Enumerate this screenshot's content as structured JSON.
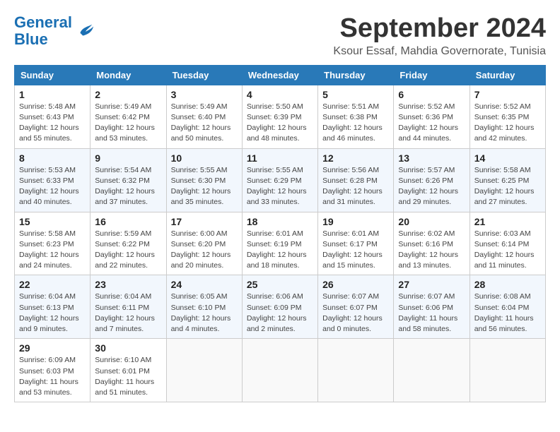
{
  "header": {
    "logo_line1": "General",
    "logo_line2": "Blue",
    "month_title": "September 2024",
    "subtitle": "Ksour Essaf, Mahdia Governorate, Tunisia"
  },
  "weekdays": [
    "Sunday",
    "Monday",
    "Tuesday",
    "Wednesday",
    "Thursday",
    "Friday",
    "Saturday"
  ],
  "weeks": [
    [
      {
        "day": "1",
        "info": "Sunrise: 5:48 AM\nSunset: 6:43 PM\nDaylight: 12 hours\nand 55 minutes."
      },
      {
        "day": "2",
        "info": "Sunrise: 5:49 AM\nSunset: 6:42 PM\nDaylight: 12 hours\nand 53 minutes."
      },
      {
        "day": "3",
        "info": "Sunrise: 5:49 AM\nSunset: 6:40 PM\nDaylight: 12 hours\nand 50 minutes."
      },
      {
        "day": "4",
        "info": "Sunrise: 5:50 AM\nSunset: 6:39 PM\nDaylight: 12 hours\nand 48 minutes."
      },
      {
        "day": "5",
        "info": "Sunrise: 5:51 AM\nSunset: 6:38 PM\nDaylight: 12 hours\nand 46 minutes."
      },
      {
        "day": "6",
        "info": "Sunrise: 5:52 AM\nSunset: 6:36 PM\nDaylight: 12 hours\nand 44 minutes."
      },
      {
        "day": "7",
        "info": "Sunrise: 5:52 AM\nSunset: 6:35 PM\nDaylight: 12 hours\nand 42 minutes."
      }
    ],
    [
      {
        "day": "8",
        "info": "Sunrise: 5:53 AM\nSunset: 6:33 PM\nDaylight: 12 hours\nand 40 minutes."
      },
      {
        "day": "9",
        "info": "Sunrise: 5:54 AM\nSunset: 6:32 PM\nDaylight: 12 hours\nand 37 minutes."
      },
      {
        "day": "10",
        "info": "Sunrise: 5:55 AM\nSunset: 6:30 PM\nDaylight: 12 hours\nand 35 minutes."
      },
      {
        "day": "11",
        "info": "Sunrise: 5:55 AM\nSunset: 6:29 PM\nDaylight: 12 hours\nand 33 minutes."
      },
      {
        "day": "12",
        "info": "Sunrise: 5:56 AM\nSunset: 6:28 PM\nDaylight: 12 hours\nand 31 minutes."
      },
      {
        "day": "13",
        "info": "Sunrise: 5:57 AM\nSunset: 6:26 PM\nDaylight: 12 hours\nand 29 minutes."
      },
      {
        "day": "14",
        "info": "Sunrise: 5:58 AM\nSunset: 6:25 PM\nDaylight: 12 hours\nand 27 minutes."
      }
    ],
    [
      {
        "day": "15",
        "info": "Sunrise: 5:58 AM\nSunset: 6:23 PM\nDaylight: 12 hours\nand 24 minutes."
      },
      {
        "day": "16",
        "info": "Sunrise: 5:59 AM\nSunset: 6:22 PM\nDaylight: 12 hours\nand 22 minutes."
      },
      {
        "day": "17",
        "info": "Sunrise: 6:00 AM\nSunset: 6:20 PM\nDaylight: 12 hours\nand 20 minutes."
      },
      {
        "day": "18",
        "info": "Sunrise: 6:01 AM\nSunset: 6:19 PM\nDaylight: 12 hours\nand 18 minutes."
      },
      {
        "day": "19",
        "info": "Sunrise: 6:01 AM\nSunset: 6:17 PM\nDaylight: 12 hours\nand 15 minutes."
      },
      {
        "day": "20",
        "info": "Sunrise: 6:02 AM\nSunset: 6:16 PM\nDaylight: 12 hours\nand 13 minutes."
      },
      {
        "day": "21",
        "info": "Sunrise: 6:03 AM\nSunset: 6:14 PM\nDaylight: 12 hours\nand 11 minutes."
      }
    ],
    [
      {
        "day": "22",
        "info": "Sunrise: 6:04 AM\nSunset: 6:13 PM\nDaylight: 12 hours\nand 9 minutes."
      },
      {
        "day": "23",
        "info": "Sunrise: 6:04 AM\nSunset: 6:11 PM\nDaylight: 12 hours\nand 7 minutes."
      },
      {
        "day": "24",
        "info": "Sunrise: 6:05 AM\nSunset: 6:10 PM\nDaylight: 12 hours\nand 4 minutes."
      },
      {
        "day": "25",
        "info": "Sunrise: 6:06 AM\nSunset: 6:09 PM\nDaylight: 12 hours\nand 2 minutes."
      },
      {
        "day": "26",
        "info": "Sunrise: 6:07 AM\nSunset: 6:07 PM\nDaylight: 12 hours\nand 0 minutes."
      },
      {
        "day": "27",
        "info": "Sunrise: 6:07 AM\nSunset: 6:06 PM\nDaylight: 11 hours\nand 58 minutes."
      },
      {
        "day": "28",
        "info": "Sunrise: 6:08 AM\nSunset: 6:04 PM\nDaylight: 11 hours\nand 56 minutes."
      }
    ],
    [
      {
        "day": "29",
        "info": "Sunrise: 6:09 AM\nSunset: 6:03 PM\nDaylight: 11 hours\nand 53 minutes."
      },
      {
        "day": "30",
        "info": "Sunrise: 6:10 AM\nSunset: 6:01 PM\nDaylight: 11 hours\nand 51 minutes."
      },
      {
        "day": "",
        "info": ""
      },
      {
        "day": "",
        "info": ""
      },
      {
        "day": "",
        "info": ""
      },
      {
        "day": "",
        "info": ""
      },
      {
        "day": "",
        "info": ""
      }
    ]
  ]
}
